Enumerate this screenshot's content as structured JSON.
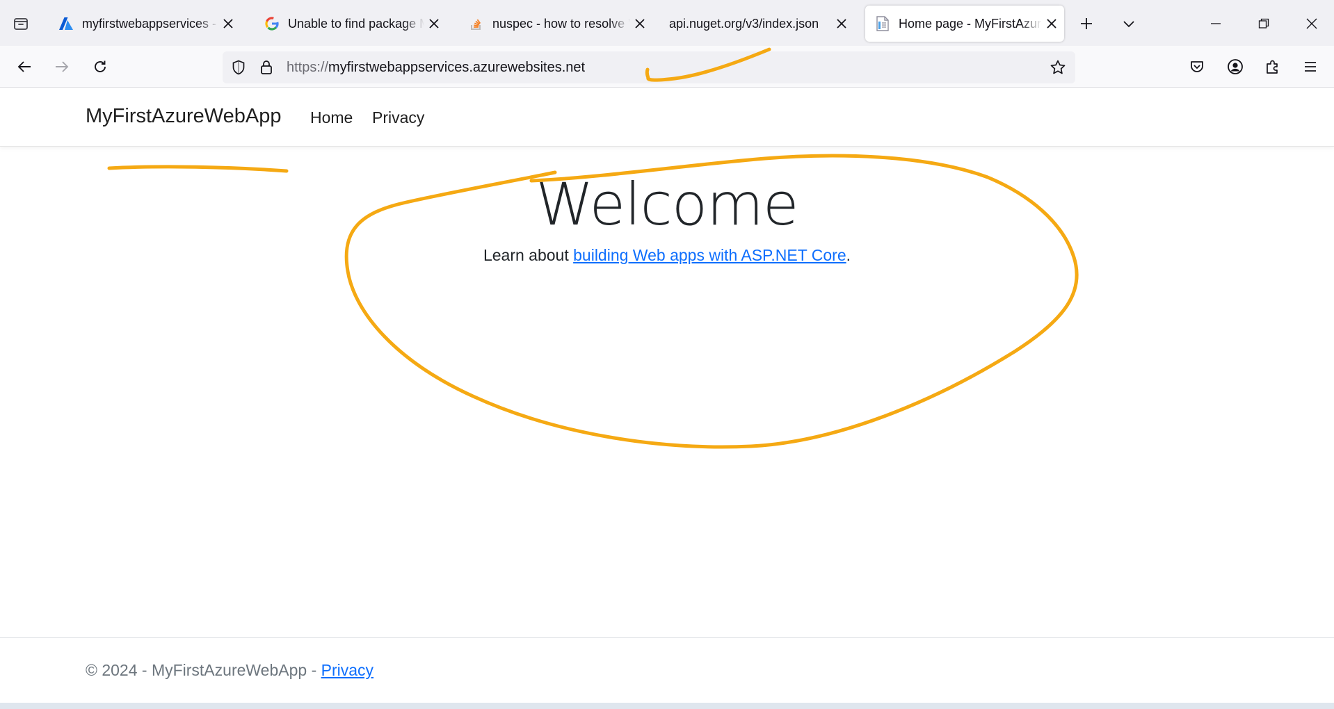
{
  "browser": {
    "tabs": [
      {
        "title": "myfirstwebappservices - Microsoft Azure",
        "icon": "azure-icon",
        "active": false
      },
      {
        "title": "Unable to find package Microsoft",
        "icon": "google-icon",
        "active": false
      },
      {
        "title": "nuspec - how to resolve \"Unable",
        "icon": "stackoverflow-icon",
        "active": false
      },
      {
        "title": "api.nuget.org/v3/index.json",
        "icon": "",
        "active": false
      },
      {
        "title": "Home page - MyFirstAzureWebApp",
        "icon": "page-icon",
        "active": true
      }
    ],
    "url_scheme": "https://",
    "url_host": "myfirstwebappservices.azurewebsites.net"
  },
  "site": {
    "brand": "MyFirstAzureWebApp",
    "nav": {
      "home": "Home",
      "privacy": "Privacy"
    },
    "heading": "Welcome",
    "learn_prefix": "Learn about ",
    "learn_link": "building Web apps with ASP.NET Core",
    "learn_suffix": ".",
    "footer_text": "© 2024 - MyFirstAzureWebApp - ",
    "footer_link": "Privacy"
  },
  "colors": {
    "annotation": "#f5a913",
    "link": "#0d6efd",
    "tab_strip": "#f0f0f4"
  }
}
